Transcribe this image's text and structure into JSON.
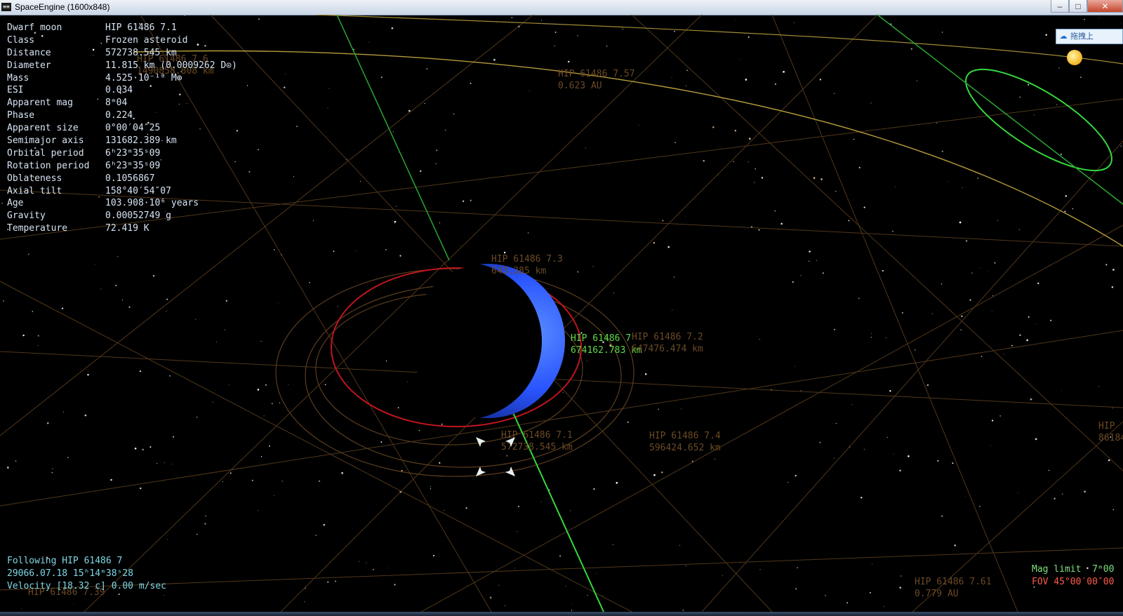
{
  "window": {
    "title": "SpaceEngine (1600x848)",
    "app_icon_glyph": "≡≡",
    "minimize_glyph": "–",
    "maximize_glyph": "□",
    "close_glyph": "✕"
  },
  "info": [
    {
      "key": "Dwarf moon",
      "value": "HIP 61486 7.1"
    },
    {
      "key": "Class",
      "value": "Frozen asteroid"
    },
    {
      "key": "Distance",
      "value": "572738.545 km"
    },
    {
      "key": "Diameter",
      "value": "11.815 km (0.0009262 D⊙)"
    },
    {
      "key": "Mass",
      "value": "4.525·10⁻¹⁰ M⊕"
    },
    {
      "key": "ESI",
      "value": "0.034"
    },
    {
      "key": "Apparent mag",
      "value": "8ᵐ04"
    },
    {
      "key": "Phase",
      "value": "0.224"
    },
    {
      "key": "Apparent size",
      "value": "0°00′04″25"
    },
    {
      "key": "Semimajor axis",
      "value": "131682.389 km"
    },
    {
      "key": "Orbital period",
      "value": "6ʰ23ᵐ35ˢ09"
    },
    {
      "key": "Rotation period",
      "value": "6ʰ23ᵐ35ˢ09"
    },
    {
      "key": "Oblateness",
      "value": "0.1056867"
    },
    {
      "key": "Axial tilt",
      "value": "158°40′54″07"
    },
    {
      "key": "Age",
      "value": "103.908·10⁶ years"
    },
    {
      "key": "Gravity",
      "value": "0.00052749 g"
    },
    {
      "key": "Temperature",
      "value": "72.419 K"
    }
  ],
  "status": {
    "following": "Following HIP 61486 7",
    "datetime": "29066.07.18 15ʰ14ᵐ38ˢ28",
    "velocity": "Velocity [18.32 c] 0.00 m/sec"
  },
  "mag": {
    "mag_limit": "Mag limit  7ᵐ00",
    "fov": "FOV 45°00′00″00"
  },
  "labels": {
    "l76_name": "HIP 61486 7.6",
    "l76_dist": "1490858.808 km",
    "l757_name": "HIP 61486 7.57",
    "l757_dist": "0.623 AU",
    "l73_name": "HIP 61486 7.3",
    "l73_dist": "643.385 km",
    "l7_name": "HIP 61486 7",
    "l7_dist": "674162.783 km",
    "l72_name": "HIP 61486 7.2",
    "l72_dist": "647476.474 km",
    "l71_name": "HIP 61486 7.1",
    "l71_dist": "572738.545 km",
    "l74_name": "HIP 61486 7.4",
    "l74_dist": "596424.652 km",
    "l761_name": "HIP 61486 7.61",
    "l761_dist": "0.779 AU",
    "l739_name": "HIP 61486 7.39",
    "edge_name": "HIP",
    "edge_dist": "86184"
  },
  "toolbar_ext": {
    "label": "拖拽上"
  },
  "colors": {
    "planet": "#2d5cff",
    "orbit_red": "#c0151d",
    "orbit_green": "#35d83d",
    "orbit_brown": "#6b4a25",
    "orbit_yellow": "#b59a3a"
  }
}
